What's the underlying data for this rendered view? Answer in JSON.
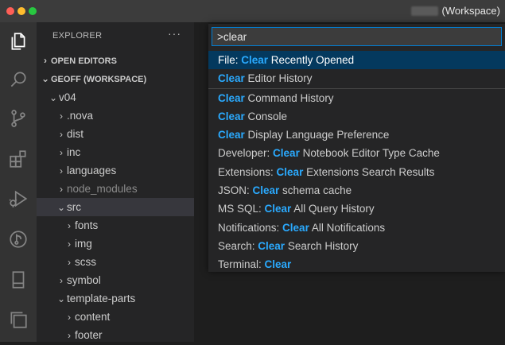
{
  "window": {
    "title": "(Workspace)"
  },
  "activity_bar": {
    "icons": [
      "explorer-icon",
      "search-icon",
      "source-control-icon",
      "extensions-icon",
      "run-debug-icon",
      "gitlens-icon",
      "remote-icon",
      "panels-icon"
    ]
  },
  "sidebar": {
    "header": "EXPLORER",
    "more": "···",
    "sections": {
      "open_editors": "OPEN EDITORS",
      "workspace": "GEOFF (WORKSPACE)"
    },
    "tree": [
      {
        "label": "v04",
        "expanded": true
      },
      {
        "label": ".nova"
      },
      {
        "label": "dist"
      },
      {
        "label": "inc"
      },
      {
        "label": "languages"
      },
      {
        "label": "node_modules"
      },
      {
        "label": "src",
        "expanded": true
      },
      {
        "label": "fonts"
      },
      {
        "label": "img"
      },
      {
        "label": "scss"
      },
      {
        "label": "symbol"
      },
      {
        "label": "template-parts",
        "expanded": true
      },
      {
        "label": "content"
      },
      {
        "label": "footer"
      }
    ]
  },
  "palette": {
    "query": ">clear",
    "results": [
      {
        "prefix": "File: ",
        "match": "Clear",
        "suffix": " Recently Opened"
      },
      {
        "prefix": "",
        "match": "Clear",
        "suffix": " Editor History"
      },
      {
        "prefix": "",
        "match": "Clear",
        "suffix": " Command History"
      },
      {
        "prefix": "",
        "match": "Clear",
        "suffix": " Console"
      },
      {
        "prefix": "",
        "match": "Clear",
        "suffix": " Display Language Preference"
      },
      {
        "prefix": "Developer: ",
        "match": "Clear",
        "suffix": " Notebook Editor Type Cache"
      },
      {
        "prefix": "Extensions: ",
        "match": "Clear",
        "suffix": " Extensions Search Results"
      },
      {
        "prefix": "JSON: ",
        "match": "Clear",
        "suffix": " schema cache"
      },
      {
        "prefix": "MS SQL: ",
        "match": "Clear",
        "suffix": " All Query History"
      },
      {
        "prefix": "Notifications: ",
        "match": "Clear",
        "suffix": " All Notifications"
      },
      {
        "prefix": "Search: ",
        "match": "Clear",
        "suffix": " Search History"
      },
      {
        "prefix": "Terminal: ",
        "match": "Clear",
        "suffix": ""
      }
    ]
  },
  "colors": {
    "accent": "#2aaaff",
    "selection": "#04395e",
    "focus_border": "#007fd4"
  }
}
